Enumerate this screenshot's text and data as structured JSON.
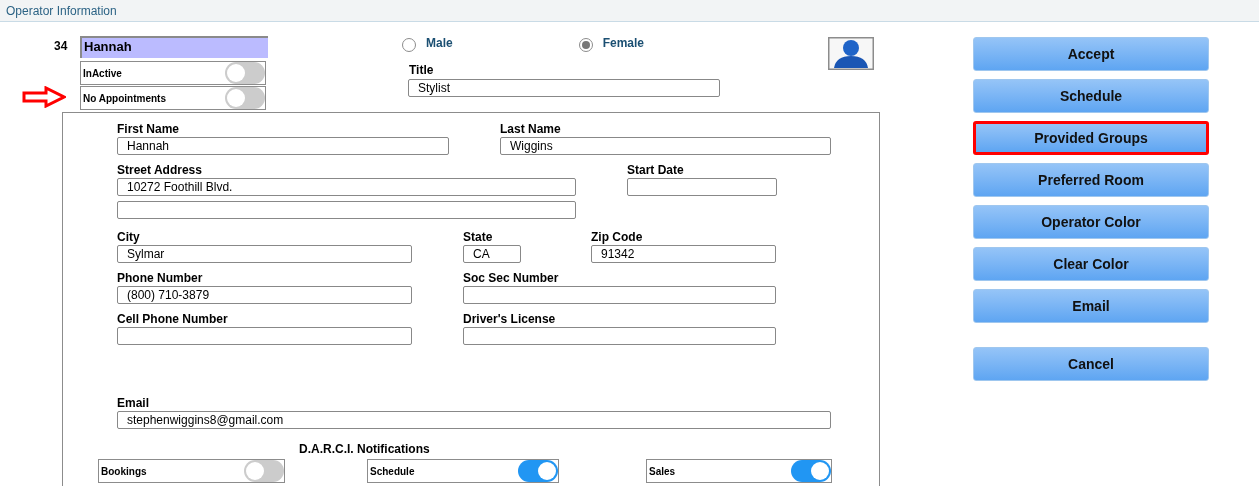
{
  "header": {
    "title": "Operator Information"
  },
  "operator": {
    "number": "34",
    "name": "Hannah"
  },
  "status_toggles": [
    {
      "label": "InActive",
      "on": false
    },
    {
      "label": "No Appointments",
      "on": false
    }
  ],
  "gender": [
    {
      "label": "Male",
      "selected": false
    },
    {
      "label": "Female",
      "selected": true
    }
  ],
  "title_field": {
    "label": "Title",
    "value": "Stylist"
  },
  "fields": [
    {
      "kind": "labeled",
      "label": "First Name",
      "value": "Hannah"
    },
    {
      "kind": "labeled",
      "label": "Last Name",
      "value": "Wiggins"
    },
    {
      "kind": "labeled",
      "label": "Street Address",
      "value": "10272 Foothill Blvd."
    },
    {
      "kind": "labeled",
      "label": "Start Date"
    },
    {
      "kind": "blank"
    },
    {
      "kind": "labeled",
      "label": "City",
      "value": "Sylmar"
    },
    {
      "kind": "labeled",
      "label": "State",
      "value": "CA"
    },
    {
      "kind": "labeled",
      "label": "Zip Code",
      "value": "91342"
    },
    {
      "kind": "labeled",
      "label": "Phone Number",
      "value": "(800) 710-3879"
    },
    {
      "kind": "labeled",
      "label": "Soc Sec Number"
    },
    {
      "kind": "labeled",
      "label": "Cell Phone Number"
    },
    {
      "kind": "labeled",
      "label": "Driver's License"
    },
    {
      "kind": "labeled",
      "label": "Email",
      "value": "stephenwiggins8@gmail.com"
    }
  ],
  "notifications": {
    "title": "D.A.R.C.I. Notifications",
    "toggles": [
      {
        "label": "Bookings",
        "on": false
      },
      {
        "label": "Schedule",
        "on": true
      },
      {
        "label": "Sales",
        "on": true
      }
    ]
  },
  "buttons": [
    {
      "label": "Accept",
      "highlighted": false
    },
    {
      "label": "Schedule",
      "highlighted": false
    },
    {
      "label": "Provided Groups",
      "highlighted": true
    },
    {
      "label": "Preferred Room",
      "highlighted": false
    },
    {
      "label": "Operator Color",
      "highlighted": false
    },
    {
      "label": "Clear Color",
      "highlighted": false
    },
    {
      "label": "Email",
      "highlighted": false
    },
    {
      "label": "Cancel",
      "highlighted": false
    }
  ]
}
